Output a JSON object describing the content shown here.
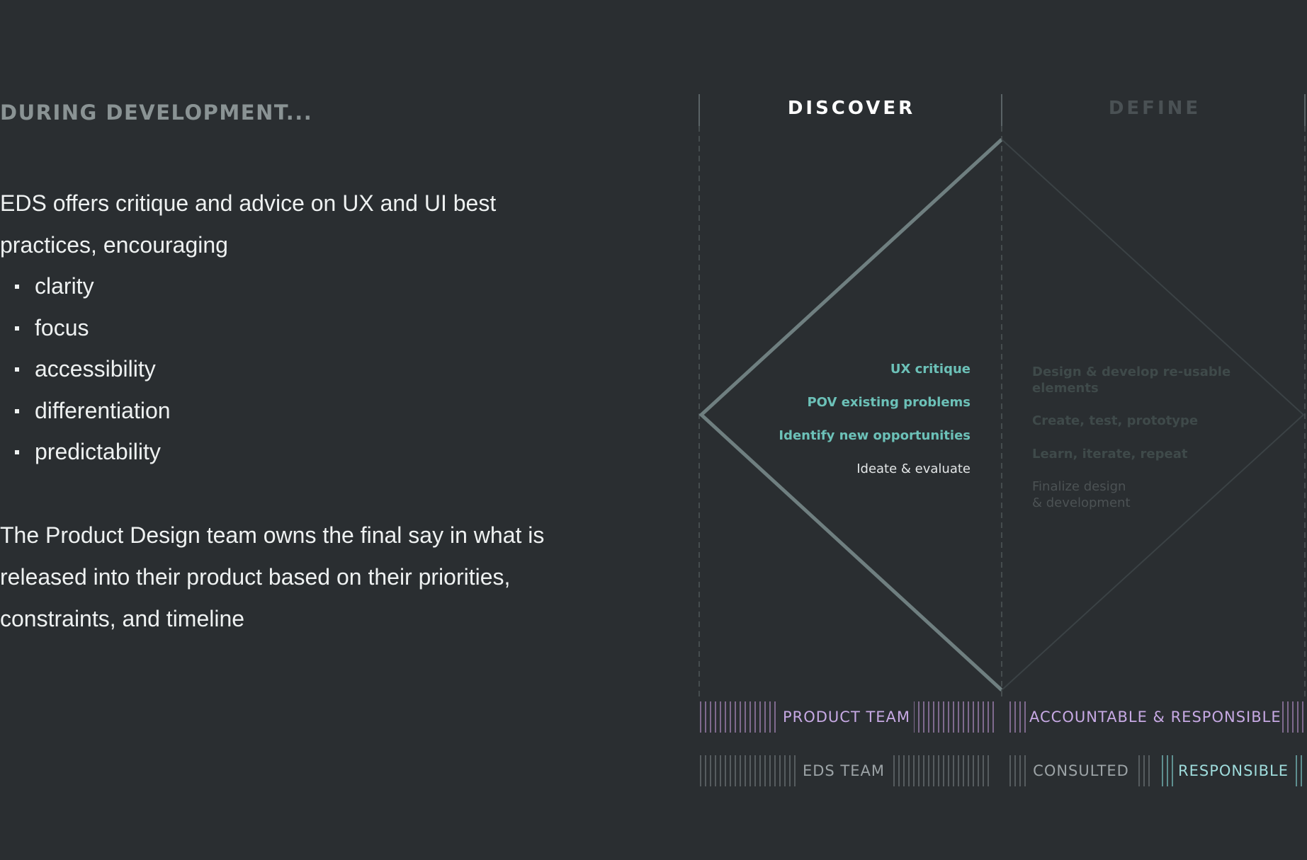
{
  "left": {
    "eyebrow": "DURING DEVELOPMENT...",
    "intro": "EDS offers critique and advice on UX and UI best practices, encouraging",
    "bullets": [
      "clarity",
      "focus",
      "accessibility",
      "differentiation",
      "predictability"
    ],
    "closing": "The Product Design team owns the final say in what is released into their product based on their priorities, constraints, and timeline"
  },
  "diagram": {
    "phases": [
      {
        "label": "DISCOVER",
        "color": "#ffffff"
      },
      {
        "label": "DEFINE",
        "color": "#4a5154"
      }
    ],
    "discover_items": [
      {
        "text": "UX critique",
        "color": "#6cc1b8",
        "bold": true
      },
      {
        "text": "POV existing problems",
        "color": "#6cc1b8",
        "bold": true
      },
      {
        "text": "Identify new opportunities",
        "color": "#6cc1b8",
        "bold": true
      },
      {
        "text": "Ideate & evaluate",
        "color": "#e3e6e7",
        "bold": false
      }
    ],
    "define_items": [
      {
        "text": "Design & develop re-usable\n elements",
        "color": "#3f4a4a",
        "bold": true
      },
      {
        "text": "Create, test, prototype",
        "color": "#3f4a4a",
        "bold": true
      },
      {
        "text": "Learn, iterate, repeat",
        "color": "#3f4a4a",
        "bold": true
      },
      {
        "text": "Finalize design\n & development",
        "color": "#4c5254",
        "bold": false
      }
    ],
    "rows": {
      "product_team": {
        "label": "PRODUCT TEAM",
        "role": "ACCOUNTABLE & RESPONSIBLE"
      },
      "eds_team": {
        "label": "EDS TEAM",
        "roles": [
          "CONSULTED",
          "RESPONSIBLE"
        ]
      }
    },
    "colors": {
      "diamond_active": "#6f7f80",
      "diamond_muted": "#3b4245",
      "purple": "#c7a9e4",
      "teal": "#9fdcdc"
    }
  }
}
